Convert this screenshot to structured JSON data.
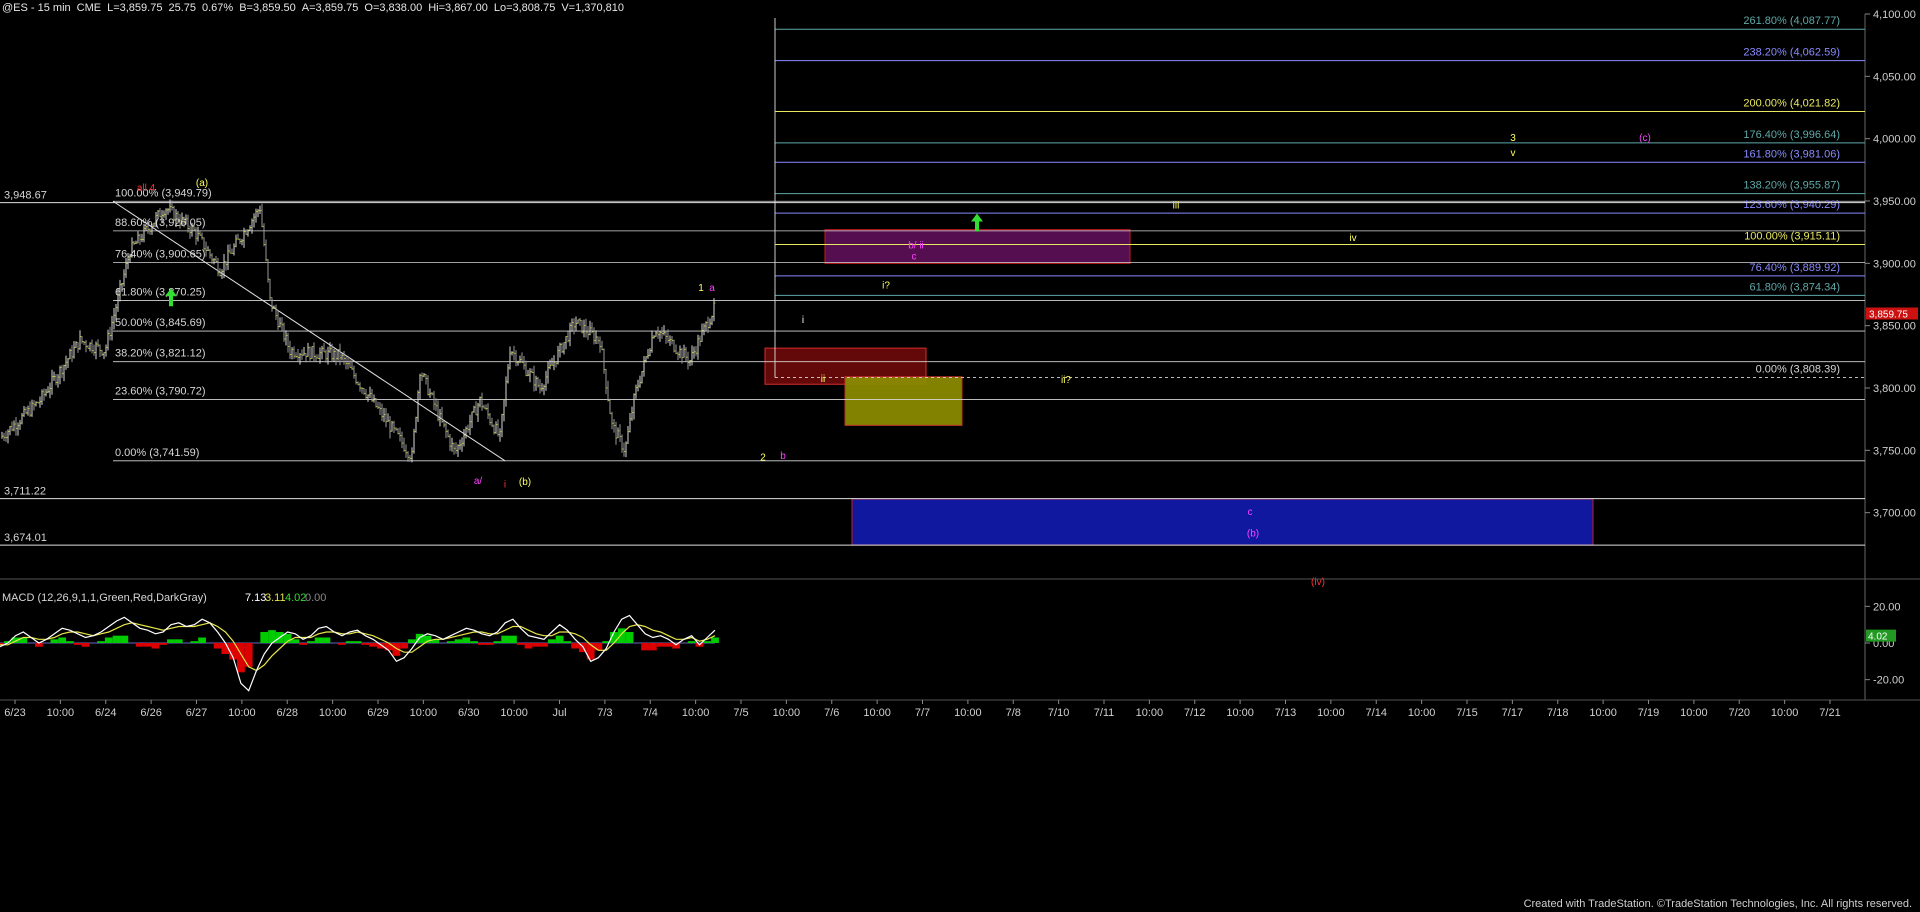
{
  "header": {
    "symbol": "@ES - 15 min",
    "exchange": "CME",
    "last": "L=3,859.75",
    "change": "25.75",
    "change_pct": "0.67%",
    "bid": "B=3,859.50",
    "ask": "A=3,859.75",
    "open": "O=3,838.00",
    "high": "Hi=3,867.00",
    "low": "Lo=3,808.75",
    "volume": "V=1,370,810"
  },
  "footer": {
    "credit": "Created with TradeStation. ©TradeStation Technologies, Inc. All rights reserved."
  },
  "colors": {
    "background": "#000000",
    "price_bar": "#c8c8c8",
    "fib_line": "#d6d6d6",
    "fib_ext_yellow": "#e8e860",
    "fib_ext_blue": "#8a8aff",
    "fib_ext_teal": "#5fa8a8",
    "macd_fast": "#ffffff",
    "macd_slow": "#e6e64a",
    "macd_hist_up": "#00cc00",
    "macd_hist_down": "#dd0000",
    "zero_line": "#8a8aff",
    "arrow_green": "#33dd33"
  },
  "chart_data": [
    {
      "type": "candlestick",
      "title": "@ES - 15 min",
      "ylim": [
        3650,
        4100
      ],
      "y_ticks": [
        "3,700.00",
        "3,750.00",
        "3,800.00",
        "3,850.00",
        "3,900.00",
        "3,950.00",
        "4,000.00",
        "4,050.00",
        "4,100.00"
      ],
      "x_tick_labels": [
        "6/23",
        "10:00",
        "6/24",
        "6/26",
        "6/27",
        "10:00",
        "6/28",
        "10:00",
        "6/29",
        "10:00",
        "6/30",
        "10:00",
        "Jul",
        "7/3",
        "7/4",
        "10:00",
        "7/5",
        "10:00",
        "7/6",
        "10:00",
        "7/7",
        "10:00",
        "7/8",
        "7/10",
        "7/11",
        "10:00",
        "7/12",
        "10:00",
        "7/13",
        "10:00",
        "7/14",
        "10:00",
        "7/15",
        "7/17",
        "7/18",
        "10:00",
        "7/19",
        "10:00",
        "7/20",
        "10:00",
        "7/21"
      ],
      "last_price": "3,859.75",
      "price_path": [
        [
          0,
          3760
        ],
        [
          40,
          3790
        ],
        [
          80,
          3838
        ],
        [
          105,
          3830
        ],
        [
          130,
          3910
        ],
        [
          165,
          3945
        ],
        [
          195,
          3925
        ],
        [
          220,
          3895
        ],
        [
          260,
          3945
        ],
        [
          270,
          3870
        ],
        [
          290,
          3830
        ],
        [
          340,
          3826
        ],
        [
          385,
          3775
        ],
        [
          412,
          3745
        ],
        [
          420,
          3815
        ],
        [
          440,
          3775
        ],
        [
          455,
          3748
        ],
        [
          480,
          3790
        ],
        [
          500,
          3760
        ],
        [
          510,
          3832
        ],
        [
          540,
          3800
        ],
        [
          575,
          3853
        ],
        [
          600,
          3838
        ],
        [
          612,
          3770
        ],
        [
          625,
          3750
        ],
        [
          635,
          3795
        ],
        [
          655,
          3848
        ],
        [
          690,
          3822
        ],
        [
          700,
          3840
        ],
        [
          715,
          3865
        ]
      ],
      "left_levels": [
        {
          "label": "100.00% (3,949.79)",
          "value": 3949.79
        },
        {
          "label": "88.60% (3,926.05)",
          "value": 3926.05
        },
        {
          "label": "76.40% (3,900.65)",
          "value": 3900.65
        },
        {
          "label": "61.80% (3,870.25)",
          "value": 3870.25
        },
        {
          "label": "50.00% (3,845.69)",
          "value": 3845.69
        },
        {
          "label": "38.20% (3,821.12)",
          "value": 3821.12
        },
        {
          "label": "23.60% (3,790.72)",
          "value": 3790.72
        },
        {
          "label": "0.00% (3,741.59)",
          "value": 3741.59
        }
      ],
      "right_levels": [
        {
          "label": "261.80% (4,087.77)",
          "value": 4087.77,
          "color": "teal"
        },
        {
          "label": "238.20% (4,062.59)",
          "value": 4062.59,
          "color": "blue"
        },
        {
          "label": "200.00% (4,021.82)",
          "value": 4021.82,
          "color": "yellow"
        },
        {
          "label": "176.40% (3,996.64)",
          "value": 3996.64,
          "color": "teal"
        },
        {
          "label": "161.80% (3,981.06)",
          "value": 3981.06,
          "color": "blue"
        },
        {
          "label": "138.20% (3,955.87)",
          "value": 3955.87,
          "color": "teal"
        },
        {
          "label": "123.60% (3,940.29)",
          "value": 3940.29,
          "color": "blue"
        },
        {
          "label": "100.00% (3,915.11)",
          "value": 3915.11,
          "color": "yellow"
        },
        {
          "label": "76.40% (3,889.92)",
          "value": 3889.92,
          "color": "blue"
        },
        {
          "label": "61.80% (3,874.34)",
          "value": 3874.34,
          "color": "teal"
        },
        {
          "label": "0.00% (3,808.39)",
          "value": 3808.39,
          "color": "white"
        }
      ],
      "edge_levels": [
        {
          "label": "3,948.67",
          "value": 3948.67
        },
        {
          "label": "3,711.22",
          "value": 3711.22
        },
        {
          "label": "3,674.01",
          "value": 3674.01
        }
      ],
      "wave_labels": [
        {
          "text": "all 4",
          "color": "#ff3030"
        },
        {
          "text": "(a)",
          "color": "#ffff60"
        },
        {
          "text": "1",
          "color": "#ffff60"
        },
        {
          "text": "a",
          "color": "#ff40ff"
        },
        {
          "text": "i?",
          "color": "#ffff60"
        },
        {
          "text": "i",
          "color": "#ffffff"
        },
        {
          "text": "b/ ii",
          "color": "#ff40ff"
        },
        {
          "text": "c",
          "color": "#ff40ff"
        },
        {
          "text": "ii",
          "color": "#ffff60"
        },
        {
          "text": "ii?",
          "color": "#ffff60"
        },
        {
          "text": "iii",
          "color": "#ffff60"
        },
        {
          "text": "iv",
          "color": "#ffff60"
        },
        {
          "text": "3",
          "color": "#ffff60"
        },
        {
          "text": "v",
          "color": "#ffff60"
        },
        {
          "text": "(c)",
          "color": "#ff40ff"
        },
        {
          "text": "2",
          "color": "#ffff60"
        },
        {
          "text": "b",
          "color": "#ff40ff"
        },
        {
          "text": "a/",
          "color": "#ff40ff"
        },
        {
          "text": "i",
          "color": "#ff3030"
        },
        {
          "text": "(b)",
          "color": "#ffff60"
        },
        {
          "text": "c",
          "color": "#ff40ff"
        },
        {
          "text": "(b)",
          "color": "#ff40ff"
        },
        {
          "text": "(iv)",
          "color": "#ff3030"
        }
      ],
      "zones": [
        {
          "name": "purple-target",
          "low": 3900,
          "high": 3927
        },
        {
          "name": "red-support",
          "low": 3803,
          "high": 3832
        },
        {
          "name": "yellow-support",
          "low": 3770,
          "high": 3809
        },
        {
          "name": "blue-target",
          "low": 3674,
          "high": 3711
        }
      ]
    },
    {
      "type": "line",
      "title": "MACD (12,26,9,1,1,Green,Red,DarkGray)",
      "values_text": [
        "7.13",
        "3.11",
        "4.02",
        "0.00"
      ],
      "ylim": [
        -30,
        30
      ],
      "y_ticks": [
        "20.00",
        "0.00",
        "-20.00"
      ],
      "last_value": "4.02",
      "series": [
        {
          "name": "MACD",
          "values": [
            -2,
            0,
            4,
            6,
            3,
            0,
            2,
            5,
            8,
            7,
            5,
            3,
            4,
            6,
            9,
            12,
            14,
            11,
            8,
            7,
            5,
            6,
            10,
            11,
            9,
            10,
            13,
            11,
            6,
            0,
            -8,
            -22,
            -26,
            -15,
            -6,
            0,
            3,
            6,
            5,
            2,
            4,
            8,
            9,
            6,
            4,
            6,
            7,
            4,
            2,
            -1,
            -4,
            -10,
            -8,
            -3,
            3,
            5,
            4,
            2,
            4,
            6,
            8,
            7,
            5,
            4,
            6,
            11,
            13,
            8,
            4,
            3,
            2,
            6,
            10,
            7,
            2,
            -2,
            -10,
            -8,
            -3,
            6,
            13,
            15,
            10,
            5,
            3,
            4,
            2,
            -1,
            2,
            4,
            -1,
            3,
            7
          ]
        },
        {
          "name": "Signal",
          "values": [
            -1,
            -1,
            1,
            3,
            3,
            2,
            2,
            3,
            5,
            6,
            6,
            5,
            4,
            5,
            6,
            8,
            10,
            11,
            10,
            9,
            8,
            7,
            8,
            9,
            9,
            9,
            10,
            11,
            9,
            6,
            1,
            -6,
            -13,
            -15,
            -12,
            -7,
            -3,
            1,
            3,
            3,
            3,
            5,
            6,
            6,
            5,
            5,
            6,
            5,
            4,
            2,
            0,
            -3,
            -5,
            -5,
            -2,
            1,
            2,
            2,
            3,
            4,
            5,
            6,
            6,
            5,
            5,
            7,
            9,
            9,
            7,
            5,
            4,
            4,
            6,
            6,
            5,
            3,
            -1,
            -4,
            -4,
            0,
            5,
            9,
            10,
            9,
            7,
            6,
            4,
            2,
            2,
            3,
            1,
            2,
            4
          ]
        }
      ]
    }
  ]
}
